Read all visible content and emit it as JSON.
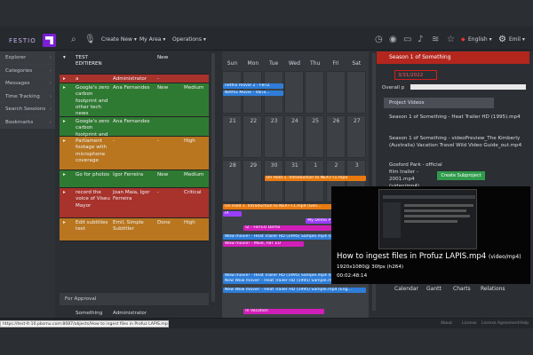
{
  "colors": {
    "green": "#2f7a32",
    "orange": "#b9761f",
    "red": "#a8322c",
    "accent": "#7a1fd6",
    "blue": "#2e7dd8",
    "purple": "#9b3dff",
    "magenta": "#d01fb8",
    "panelHeader": "#b3261e",
    "dateBadge": "#d21f1f",
    "createBtn": "#2f9b4b"
  },
  "topbar": {
    "logo": "FESTIO",
    "create_new": "Create New ▾",
    "my_area": "My Area ▾",
    "operations": "Operations ▾",
    "language": "English ▾",
    "user": "Emil ▾"
  },
  "sidebar": {
    "items": [
      "Explorer",
      "Categories",
      "Messages",
      "Time Tracking",
      "Search Sessions",
      "Bookmarks"
    ]
  },
  "tasks": {
    "rows": [
      {
        "title": "TEST EDITIEREN",
        "user": "",
        "status": "New",
        "priority": "",
        "color": "#2b2e33"
      },
      {
        "title": "a",
        "user": "Administrator",
        "status": "-",
        "priority": "",
        "color": "#a8322c"
      },
      {
        "title": "Google's zero carbon footprint and other tech news",
        "user": "Ana Fernandes",
        "status": "New",
        "priority": "Medium",
        "color": "#2f7a32"
      },
      {
        "title": "Google's zero carbon footprint and other tech news",
        "user": "Ana Fernandes",
        "status": "",
        "priority": "",
        "color": "#2f7a32"
      },
      {
        "title": "Parliament footage with microphone coverage",
        "user": "-",
        "status": "-",
        "priority": "High",
        "color": "#b9761f"
      },
      {
        "title": "Go for photos",
        "user": "Igor Ferreira",
        "status": "New",
        "priority": "Medium",
        "color": "#2f7a32"
      },
      {
        "title": "record the voice of Viseu Mayor",
        "user": "Joan Maia, Igor Ferreira",
        "status": "-",
        "priority": "Critical",
        "color": "#a8322c"
      },
      {
        "title": "Edit subtitles text",
        "user": "Emil, Simple Subtitler",
        "status": "Done",
        "priority": "High",
        "color": "#b9761f"
      }
    ],
    "for_approval": "For Approval",
    "last_row": {
      "title": "Something",
      "user": "Administrator"
    }
  },
  "calendar": {
    "days": [
      "Sun",
      "Mon",
      "Tue",
      "Wed",
      "Thu",
      "Fri",
      "Sat"
    ],
    "week1": [
      "",
      "",
      "",
      "",
      "",
      "",
      ""
    ],
    "week2": [
      "21",
      "22",
      "23",
      "24",
      "25",
      "26",
      "27"
    ],
    "week3": [
      "28",
      "29",
      "30",
      "31",
      "1",
      "2",
      "3"
    ],
    "events": [
      {
        "label": "netflix movie 2 - FBTZ",
        "color": "#2e7dd8",
        "row": 0,
        "start": 0,
        "span": 3
      },
      {
        "label": "Netflix Movie - Varia...",
        "color": "#2e7dd8",
        "row": 0,
        "start": 0,
        "span": 3
      },
      {
        "label": "On Hold 1. Introduction to NEXT-T1.mp4",
        "color": "#e87a10",
        "row": 1,
        "start": 2,
        "span": 5
      },
      {
        "label": "On Hold 1. Introduction to NEXT-T1.mp4 (Gen...",
        "color": "#e87a10",
        "row": 2,
        "start": 0,
        "span": 7
      },
      {
        "label": "IA",
        "color": "#9b3dff",
        "row": 2,
        "start": 0,
        "span": 1
      },
      {
        "label": "My Demo P",
        "color": "#9b3dff",
        "row": 2,
        "start": 4,
        "span": 2
      },
      {
        "label": "IZ - FBTEU Demo",
        "color": "#d01fb8",
        "row": 2,
        "start": 1,
        "span": 5
      },
      {
        "label": "Wow movie! - Heat Trailer HD (1995) Sample.mp4 (Ger...",
        "color": "#2e7dd8",
        "row": 3,
        "start": 0,
        "span": 7
      },
      {
        "label": "Wow movie! - Moie, FBT EU",
        "color": "#d01fb8",
        "row": 3,
        "start": 0,
        "span": 4
      },
      {
        "label": "Wow movie! - Heat Trailer HD (1995) Sample.mp4 (Ger...",
        "color": "#2e7dd8",
        "row": 3,
        "start": 0,
        "span": 7
      },
      {
        "label": "New Wow movie! - Heat Trailer HD (1995) Sample.mp4 (Eng...",
        "color": "#2e7dd8",
        "row": 3,
        "start": 0,
        "span": 7
      },
      {
        "label": "New Wow movie! - Heat Trailer HD (1995) Sample.mp4 (Eng...",
        "color": "#2e7dd8",
        "row": 3,
        "start": 0,
        "span": 7
      },
      {
        "label": "In Vacation",
        "color": "#d01fb8",
        "row": 3,
        "start": 1,
        "span": 4
      }
    ]
  },
  "panel": {
    "title": "Season 1 of Something",
    "date": "3/31/2022",
    "overall": "Overall p",
    "project_videos": "Project Videos",
    "items": [
      "Season 1 of Something - Heat Trailer HD (1995).mp4",
      "Season 1 of Something - videoPreview_The Kimberly (Australia) Vacation Travel Wild Video Guide_out.mp4",
      "Gosford Park - official film trailer - 2001.mp4 (video/mp4)"
    ],
    "create_subproject": "Create Subproject",
    "tabs": [
      "Calendar",
      "Gantt",
      "Charts",
      "Relations"
    ]
  },
  "tooltip": {
    "title": "How to ingest files in Profuz LAPIS.mp4",
    "mime": "(video/mp4)",
    "meta": "1920x1080@ 30fps (h264)",
    "duration": "00:02:48:14"
  },
  "footer": {
    "about": "About",
    "license": "License",
    "license_agreement": "License Agreement",
    "help": "Help"
  },
  "status_url": "https://test-lt-10.pbsmu.com:8087/objects/How to ingest files in Profuz LAPIS.mp4/4519"
}
